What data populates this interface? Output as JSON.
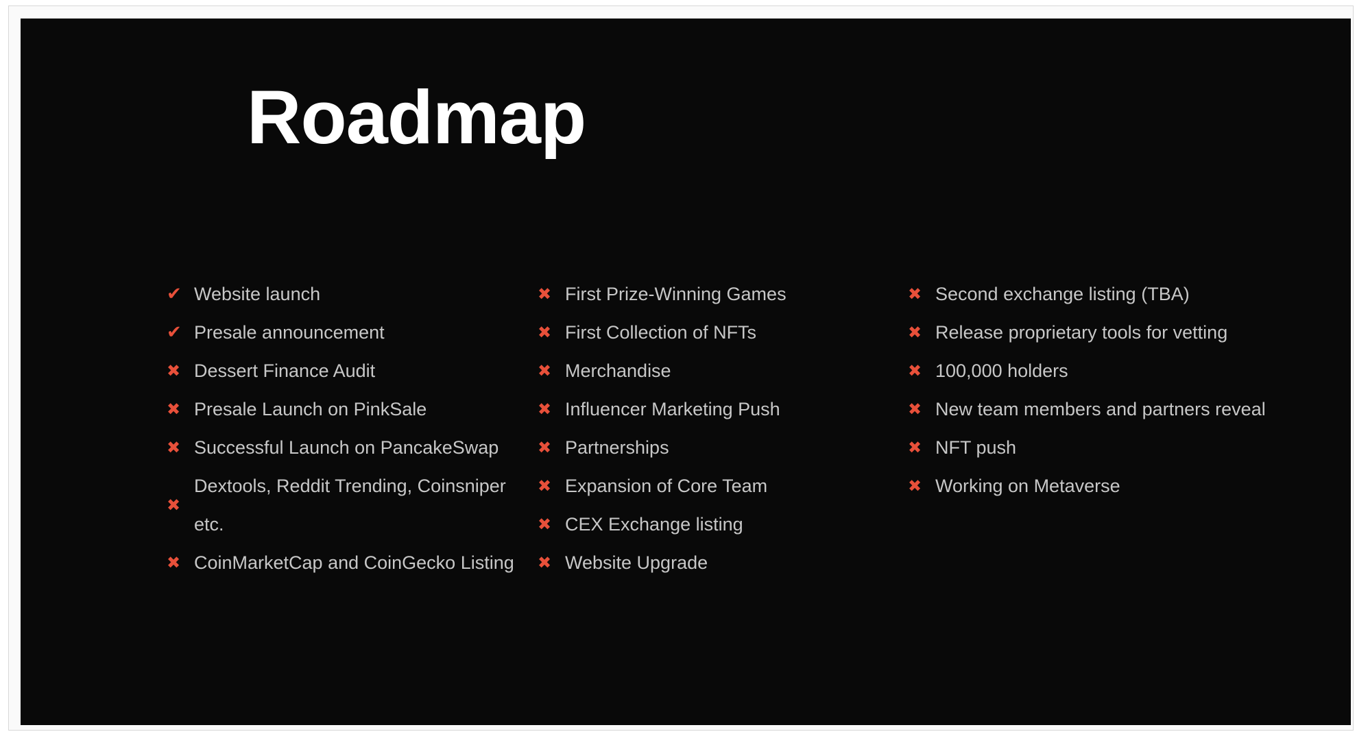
{
  "title": "Roadmap",
  "icons": {
    "done": "✔",
    "pending": "✖"
  },
  "colors": {
    "background": "#090909",
    "title": "#ffffff",
    "text": "#c7c7c7",
    "marker": "#e8503a"
  },
  "columns": [
    {
      "items": [
        {
          "status": "done",
          "icon": "check-icon",
          "label": "Website launch"
        },
        {
          "status": "done",
          "icon": "check-icon",
          "label": "Presale announcement"
        },
        {
          "status": "pending",
          "icon": "cross-icon",
          "label": "Dessert Finance Audit"
        },
        {
          "status": "pending",
          "icon": "cross-icon",
          "label": "Presale Launch on PinkSale"
        },
        {
          "status": "pending",
          "icon": "cross-icon",
          "label": "Successful Launch on PancakeSwap"
        },
        {
          "status": "pending",
          "icon": "cross-icon",
          "label": "Dextools, Reddit Trending, Coinsniper etc."
        },
        {
          "status": "pending",
          "icon": "cross-icon",
          "label": "CoinMarketCap and CoinGecko Listing"
        }
      ]
    },
    {
      "items": [
        {
          "status": "pending",
          "icon": "cross-icon",
          "label": "First Prize-Winning Games"
        },
        {
          "status": "pending",
          "icon": "cross-icon",
          "label": "First Collection of NFTs"
        },
        {
          "status": "pending",
          "icon": "cross-icon",
          "label": "Merchandise"
        },
        {
          "status": "pending",
          "icon": "cross-icon",
          "label": "Influencer Marketing Push"
        },
        {
          "status": "pending",
          "icon": "cross-icon",
          "label": "Partnerships"
        },
        {
          "status": "pending",
          "icon": "cross-icon",
          "label": "Expansion of Core Team"
        },
        {
          "status": "pending",
          "icon": "cross-icon",
          "label": "CEX Exchange listing"
        },
        {
          "status": "pending",
          "icon": "cross-icon",
          "label": "Website Upgrade"
        }
      ]
    },
    {
      "items": [
        {
          "status": "pending",
          "icon": "cross-icon",
          "label": "Second exchange listing (TBA)"
        },
        {
          "status": "pending",
          "icon": "cross-icon",
          "label": "Release proprietary tools for vetting"
        },
        {
          "status": "pending",
          "icon": "cross-icon",
          "label": "100,000 holders"
        },
        {
          "status": "pending",
          "icon": "cross-icon",
          "label": "New team members and partners reveal"
        },
        {
          "status": "pending",
          "icon": "cross-icon",
          "label": "NFT push"
        },
        {
          "status": "pending",
          "icon": "cross-icon",
          "label": "Working on Metaverse"
        }
      ]
    }
  ]
}
